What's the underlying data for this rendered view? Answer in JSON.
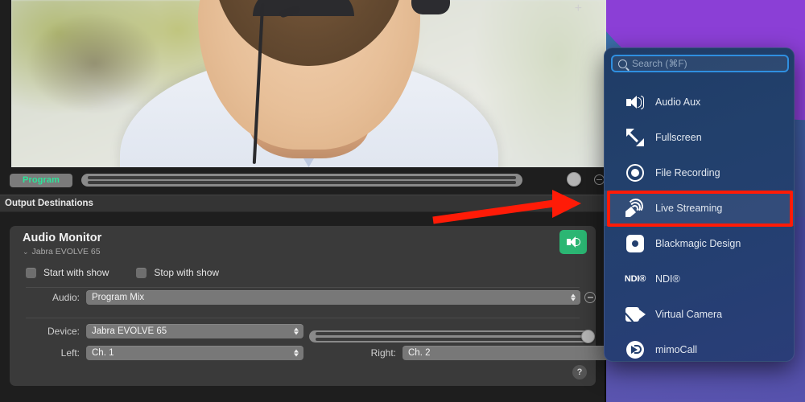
{
  "app": {
    "video_preview": {
      "description": "smiling bearded man wearing a headset in a bright office"
    },
    "program_bar": {
      "badge_label": "Program",
      "meter_name": "program-audio-meter"
    },
    "output_destinations": {
      "title": "Output Destinations",
      "add_label": "+"
    },
    "audio_monitor": {
      "title": "Audio Monitor",
      "subtitle": "Jabra EVOLVE 65",
      "chevron": "⌄",
      "speaker_icon": "speaker-icon",
      "checkboxes": [
        {
          "label": "Start with show",
          "checked": false
        },
        {
          "label": "Stop with show",
          "checked": false
        }
      ],
      "fields": [
        {
          "label": "Audio:",
          "value": "Program Mix"
        },
        {
          "label": "Device:",
          "value": "Jabra EVOLVE 65"
        },
        {
          "label": "Left:",
          "value": "Ch. 1"
        },
        {
          "label": "Right:",
          "value": "Ch. 2"
        }
      ],
      "help_label": "?",
      "remove_label": "−"
    }
  },
  "dropdown": {
    "search": {
      "placeholder": "Search (⌘F)",
      "value": "",
      "icon": "search-icon"
    },
    "items": [
      {
        "label": "Audio Aux",
        "icon": "speaker-icon",
        "selected": false
      },
      {
        "label": "Fullscreen",
        "icon": "fullscreen-icon",
        "selected": false
      },
      {
        "label": "File Recording",
        "icon": "record-icon",
        "selected": false
      },
      {
        "label": "Live Streaming",
        "icon": "live-streaming-icon",
        "selected": true
      },
      {
        "label": "Blackmagic Design",
        "icon": "blackmagic-icon",
        "selected": false
      },
      {
        "label": "NDI®",
        "icon": "ndi-icon",
        "selected": false
      },
      {
        "label": "Virtual Camera",
        "icon": "virtual-camera-icon",
        "selected": false
      },
      {
        "label": "mimoCall",
        "icon": "mimocall-icon",
        "selected": false
      }
    ]
  },
  "annotation": {
    "arrow_color": "#ff1b07",
    "highlight_color": "#ff1b07",
    "highlight_target": "Live Streaming",
    "arrow_target": "add-destination-button"
  },
  "colors": {
    "accent_green": "#2bb673",
    "program_text": "#2de59a",
    "panel_bg": "#3a3a3a",
    "window_bg": "#1e1e1e",
    "dropdown_bg": "#22406c",
    "search_focus": "#2f8fe0",
    "annotation_red": "#ff1b07"
  }
}
